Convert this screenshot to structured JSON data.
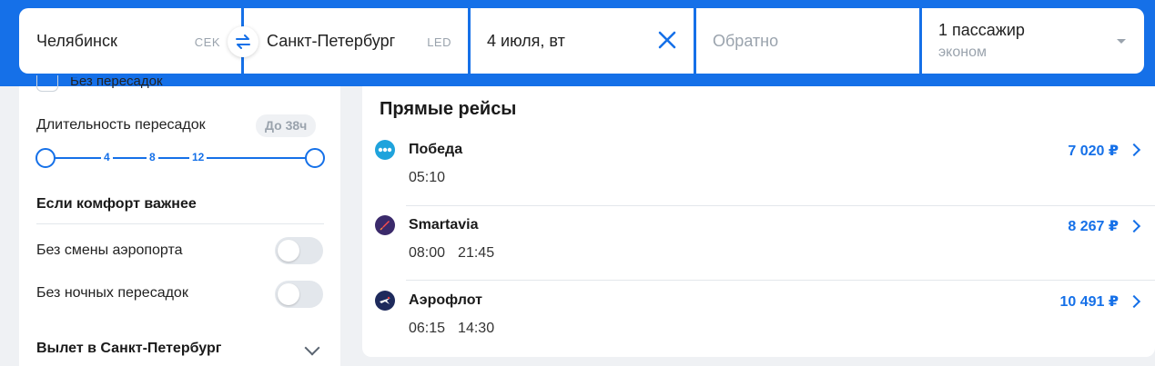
{
  "search": {
    "origin_city": "Челябинск",
    "origin_iata": "CEK",
    "dest_city": "Санкт-Петербург",
    "dest_iata": "LED",
    "date": "4 июля, вт",
    "return_placeholder": "Обратно",
    "passengers": "1 пассажир",
    "cabin_class": "эконом"
  },
  "filters": {
    "partial_label": "Без пересадок",
    "duration_label": "Длительность пересадок",
    "duration_badge": "До 38ч",
    "duration_ticks": [
      "4",
      "8",
      "12"
    ],
    "duration_range": [
      0,
      38
    ],
    "comfort_title": "Если комфорт важнее",
    "no_airport_change": "Без смены аэропорта",
    "no_night_transfers": "Без ночных пересадок",
    "no_airport_change_on": false,
    "no_night_transfers_on": false,
    "departure_section": "Вылет в Санкт-Петербург"
  },
  "results": {
    "title": "Прямые рейсы",
    "flights": [
      {
        "airline": "Победа",
        "times": [
          "05:10"
        ],
        "price": "7 020 ₽",
        "logo": "pobeda-logo-icon"
      },
      {
        "airline": "Smartavia",
        "times": [
          "08:00",
          "21:45"
        ],
        "price": "8 267 ₽",
        "logo": "smartavia-logo-icon"
      },
      {
        "airline": "Аэрофлот",
        "times": [
          "06:15",
          "14:30"
        ],
        "price": "10 491 ₽",
        "logo": "aeroflot-logo-icon"
      }
    ]
  },
  "colors": {
    "accent": "#1570e8",
    "muted": "#9aa3ad",
    "background": "#eff1f4"
  }
}
